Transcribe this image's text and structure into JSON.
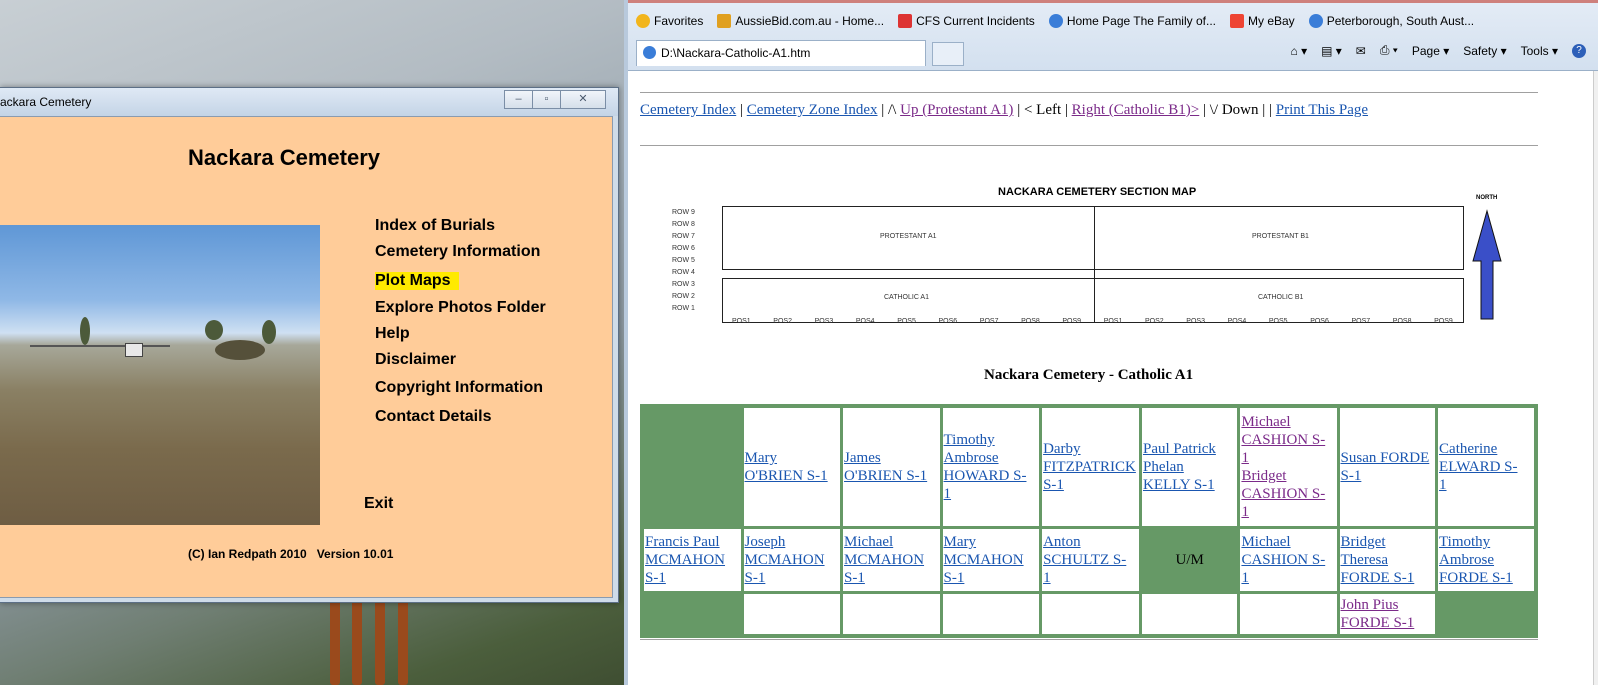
{
  "app_window": {
    "title": "ackara Cemetery",
    "heading": "Nackara Cemetery",
    "menu": [
      "Index of Burials",
      "Cemetery Information",
      "Plot Maps",
      "Explore Photos Folder",
      "Help",
      "Disclaimer",
      "Copyright Information",
      "Contact Details"
    ],
    "highlighted": "Plot Maps",
    "exit_label": "Exit",
    "credit": "(C) Ian Redpath 2010   Version 10.01",
    "minimize": "–",
    "maximize": "▫",
    "close": "✕"
  },
  "browser": {
    "favorites": [
      {
        "label": "Favorites",
        "color": "#f2b51c"
      },
      {
        "label": "AussieBid.com.au - Home...",
        "color": "#e0a020"
      },
      {
        "label": "CFS  Current Incidents",
        "color": "#d33"
      },
      {
        "label": "Home Page The Family of...",
        "color": "#3a7dd8"
      },
      {
        "label": "My eBay",
        "color": "#e43"
      },
      {
        "label": "Peterborough, South Aust...",
        "color": "#3a7dd8"
      }
    ],
    "tab_title": "D:\\Nackara-Catholic-A1.htm",
    "commands": [
      "Page ▾",
      "Safety ▾",
      "Tools ▾",
      "?"
    ],
    "nav": {
      "cemetery_index": "Cemetery Index",
      "sep1": " | ",
      "zone_index": "Cemetery Zone Index",
      "sep2": " | /\\ ",
      "up": "Up (Protestant A1)",
      "sep3": " | < Left | ",
      "right": "Right (Catholic B1)>",
      "sep4": " | \\/ Down | | ",
      "print": "Print This Page"
    },
    "map": {
      "title": "NACKARA CEMETERY SECTION MAP",
      "sections": [
        "PROTESTANT A1",
        "PROTESTANT B1",
        "CATHOLIC A1",
        "CATHOLIC B1"
      ],
      "rows": [
        "ROW 9",
        "ROW 8",
        "ROW 7",
        "ROW 6",
        "ROW 5",
        "ROW 4",
        "ROW 3",
        "ROW 2",
        "ROW 1"
      ],
      "positions": [
        "POS1",
        "POS2",
        "POS3",
        "POS4",
        "POS5",
        "POS6",
        "POS7",
        "POS8",
        "POS9",
        "POS1",
        "POS2",
        "POS3",
        "POS4",
        "POS5",
        "POS6",
        "POS7",
        "POS8",
        "POS9"
      ],
      "north": "NORTH"
    },
    "section_title": "Nackara Cemetery - Catholic A1",
    "grid": [
      [
        {
          "type": "green"
        },
        {
          "type": "link",
          "lines": [
            "Mary",
            "O'BRIEN S-1"
          ]
        },
        {
          "type": "link",
          "lines": [
            "James",
            "O'BRIEN S-1"
          ]
        },
        {
          "type": "link",
          "lines": [
            "Timothy",
            "Ambrose",
            "HOWARD S-",
            "1"
          ]
        },
        {
          "type": "link",
          "lines": [
            "Darby",
            "FITZPATRICK",
            "S-1"
          ]
        },
        {
          "type": "link",
          "lines": [
            "Paul Patrick",
            "Phelan",
            "KELLY S-1"
          ]
        },
        {
          "type": "visited",
          "lines": [
            "Michael",
            "CASHION S-",
            "1",
            "Bridget",
            "CASHION S-",
            "1"
          ]
        },
        {
          "type": "link",
          "lines": [
            "Susan FORDE",
            "S-1"
          ]
        },
        {
          "type": "link",
          "lines": [
            "Catherine",
            "ELWARD S-",
            "1"
          ]
        }
      ],
      [
        {
          "type": "link",
          "lines": [
            "Francis Paul",
            "MCMAHON",
            "S-1"
          ]
        },
        {
          "type": "link",
          "lines": [
            "Joseph",
            "MCMAHON",
            "S-1"
          ]
        },
        {
          "type": "link",
          "lines": [
            "Michael",
            "MCMAHON",
            "S-1"
          ]
        },
        {
          "type": "link",
          "lines": [
            "Mary",
            "MCMAHON",
            "S-1"
          ]
        },
        {
          "type": "link",
          "lines": [
            "Anton",
            "SCHULTZ S-",
            "1"
          ]
        },
        {
          "type": "um",
          "lines": [
            "U/M"
          ]
        },
        {
          "type": "link",
          "lines": [
            "Michael",
            "CASHION S-",
            "1"
          ]
        },
        {
          "type": "link",
          "lines": [
            "Bridget",
            "Theresa",
            "FORDE S-1"
          ]
        },
        {
          "type": "link",
          "lines": [
            "Timothy",
            "Ambrose",
            "FORDE S-1"
          ]
        }
      ],
      [
        {
          "type": "green"
        },
        {
          "type": "empty"
        },
        {
          "type": "empty"
        },
        {
          "type": "empty"
        },
        {
          "type": "empty"
        },
        {
          "type": "empty"
        },
        {
          "type": "empty"
        },
        {
          "type": "visited",
          "lines": [
            "John Pius",
            "FORDE S-1"
          ]
        },
        {
          "type": "green"
        }
      ]
    ]
  }
}
